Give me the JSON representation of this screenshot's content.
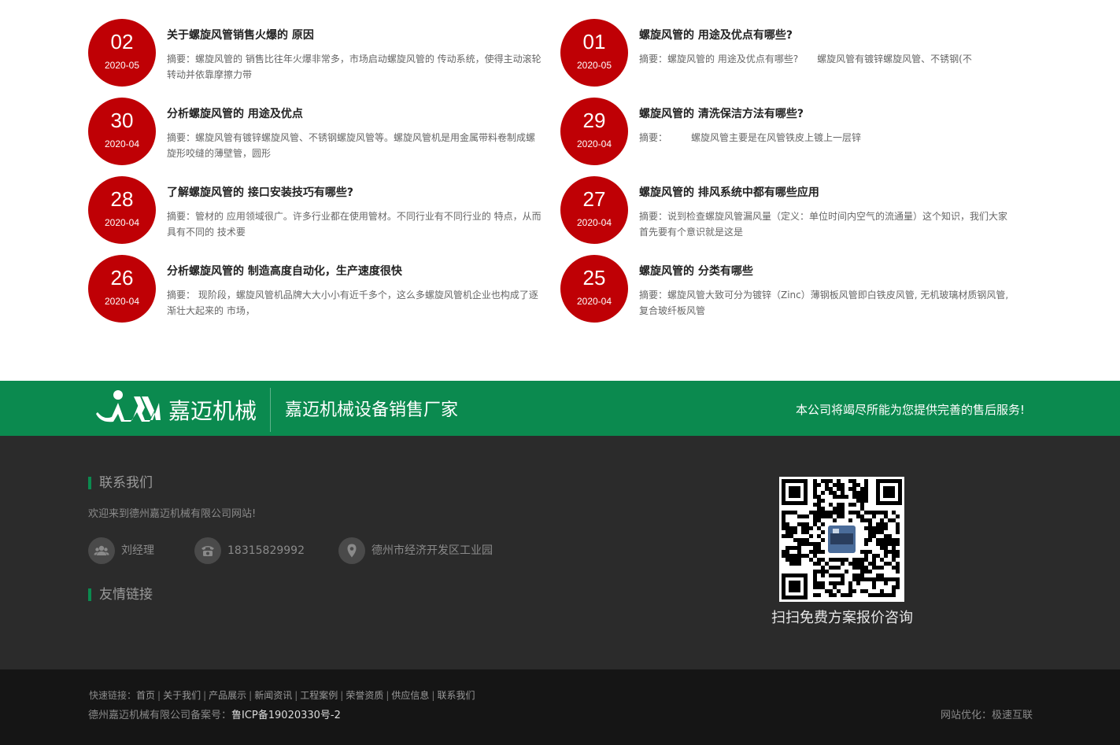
{
  "news": [
    {
      "day": "02",
      "ym": "2020-05",
      "title": "关于螺旋风管销售火爆的 原因",
      "summary": "摘要：螺旋风管的 销售比往年火爆非常多，市场启动螺旋风管的 传动系统，使得主动滚轮转动并依靠摩擦力带"
    },
    {
      "day": "01",
      "ym": "2020-05",
      "title": "螺旋风管的 用途及优点有哪些?",
      "summary": "摘要：螺旋风管的 用途及优点有哪些?　　螺旋风管有镀锌螺旋风管、不锈钢(不"
    },
    {
      "day": "30",
      "ym": "2020-04",
      "title": "分析螺旋风管的 用途及优点",
      "summary": "摘要：螺旋风管有镀锌螺旋风管、不锈钢螺旋风管等。螺旋风管机是用金属带料卷制成螺旋形咬缝的薄壁管，圆形"
    },
    {
      "day": "29",
      "ym": "2020-04",
      "title": "螺旋风管的 清洗保洁方法有哪些?",
      "summary": "摘要：　　　螺旋风管主要是在风管铁皮上镀上一层锌"
    },
    {
      "day": "28",
      "ym": "2020-04",
      "title": "了解螺旋风管的 接口安装技巧有哪些?",
      "summary": "摘要：管材的 应用领域很广。许多行业都在使用管材。不同行业有不同行业的 特点，从而具有不同的 技术要"
    },
    {
      "day": "27",
      "ym": "2020-04",
      "title": "螺旋风管的 排风系统中都有哪些应用",
      "summary": "摘要：说到检查螺旋风管漏风量（定义：单位时间内空气的流通量）这个知识，我们大家首先要有个意识就是这是"
    },
    {
      "day": "26",
      "ym": "2020-04",
      "title": "分析螺旋风管的 制造高度自动化，生产速度很快",
      "summary": "摘要： 现阶段，螺旋风管机品牌大大小小有近千多个，这么多螺旋风管机企业也构成了逐渐壮大起来的 市场，"
    },
    {
      "day": "25",
      "ym": "2020-04",
      "title": "螺旋风管的 分类有哪些",
      "summary": "摘要：螺旋风管大致可分为镀锌（Zinc）薄钢板风管即白铁皮风管, 无机玻璃材质钢风管,复合玻纤板风管"
    }
  ],
  "banner": {
    "logo_text": "嘉迈机械",
    "slogan": "嘉迈机械设备销售厂家",
    "service": "本公司将竭尽所能为您提供完善的售后服务!"
  },
  "contact": {
    "heading": "联系我们",
    "welcome": "欢迎来到德州嘉迈机械有限公司网站!",
    "person": "刘经理",
    "phone": "18315829992",
    "address": "德州市经济开发区工业园",
    "links_heading": "友情链接",
    "qr_caption": "扫扫免费方案报价咨询"
  },
  "footer": {
    "quick_label": "快速链接：",
    "links": [
      "首页",
      "关于我们",
      "产品展示",
      "新闻资讯",
      "工程案例",
      "荣誉资质",
      "供应信息",
      "联系我们"
    ],
    "icp_label": "德州嘉迈机械有限公司备案号：",
    "icp_number": "鲁ICP备19020330号-2",
    "optimize": "网站优化：极速互联"
  },
  "colors": {
    "date_red": "#bf0005",
    "brand_green": "#0b8a4f",
    "dark_bg": "#2b2b2b",
    "footer_bg": "#151515"
  },
  "icons": {
    "person": "users-icon",
    "phone": "phone-icon",
    "address": "map-pin-icon"
  }
}
